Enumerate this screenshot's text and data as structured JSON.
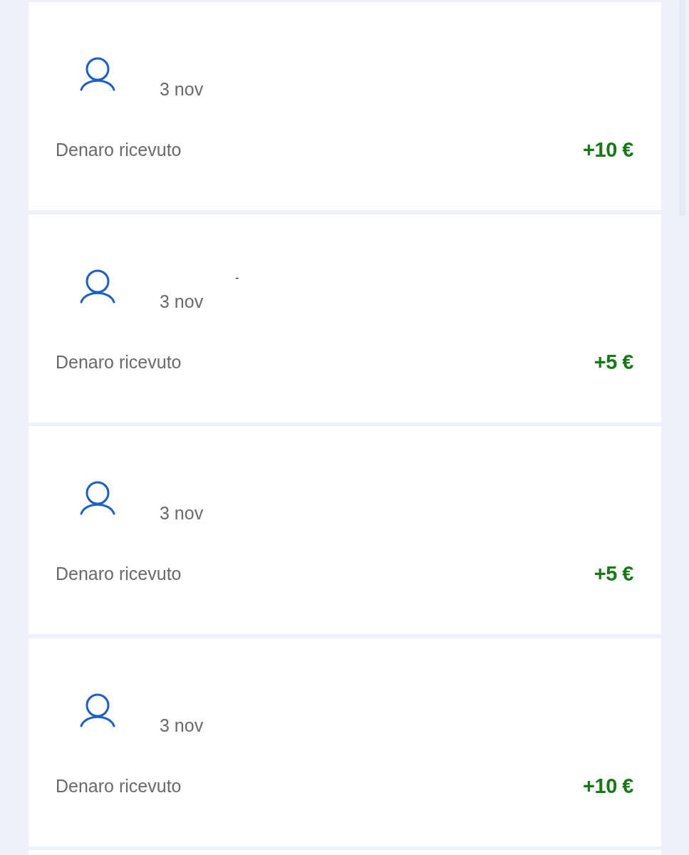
{
  "transactions": [
    {
      "date": "3 nov",
      "description": "Denaro ricevuto",
      "amount": "+10 €",
      "kind": "credit"
    },
    {
      "name": "-",
      "date": "3 nov",
      "description": "Denaro ricevuto",
      "amount": "+5 €",
      "kind": "credit"
    },
    {
      "date": "3 nov",
      "description": "Denaro ricevuto",
      "amount": "+5 €",
      "kind": "credit"
    },
    {
      "date": "3 nov",
      "description": "Denaro ricevuto",
      "amount": "+10 €",
      "kind": "credit"
    }
  ]
}
